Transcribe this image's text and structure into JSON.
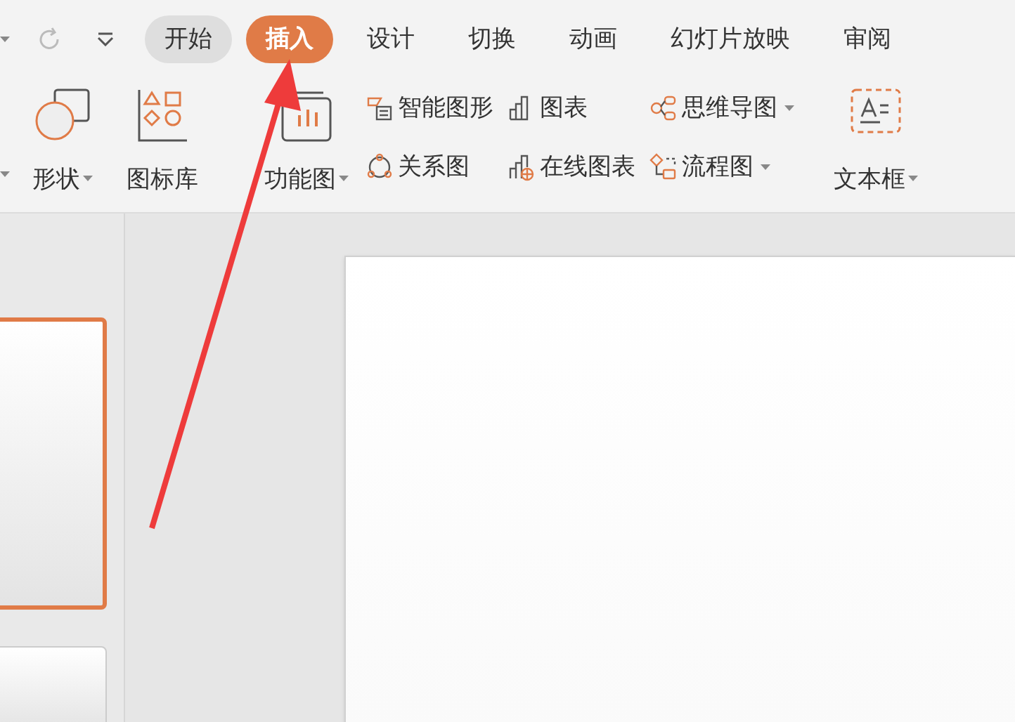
{
  "tabs": [
    {
      "label": "开始",
      "selected": false,
      "hovered": true
    },
    {
      "label": "插入",
      "selected": true,
      "hovered": false
    },
    {
      "label": "设计",
      "selected": false,
      "hovered": false
    },
    {
      "label": "切换",
      "selected": false,
      "hovered": false
    },
    {
      "label": "动画",
      "selected": false,
      "hovered": false
    },
    {
      "label": "幻灯片放映",
      "selected": false,
      "hovered": false
    },
    {
      "label": "审阅",
      "selected": false,
      "hovered": false
    }
  ],
  "ribbon": {
    "large": [
      {
        "kind": "shape",
        "label": "形状",
        "dropdown": true
      },
      {
        "kind": "iconlib",
        "label": "图标库",
        "dropdown": false
      },
      {
        "kind": "function",
        "label": "功能图",
        "dropdown": true
      }
    ],
    "small_columns": [
      [
        {
          "kind": "smart",
          "label": "智能图形",
          "dropdown": false
        },
        {
          "kind": "relation",
          "label": "关系图",
          "dropdown": false
        }
      ],
      [
        {
          "kind": "chart",
          "label": "图表",
          "dropdown": false
        },
        {
          "kind": "online",
          "label": "在线图表",
          "dropdown": false
        }
      ],
      [
        {
          "kind": "mind",
          "label": "思维导图",
          "dropdown": true
        },
        {
          "kind": "flow",
          "label": "流程图",
          "dropdown": true
        }
      ]
    ],
    "textbox": {
      "label": "文本框",
      "dropdown": true
    }
  },
  "thumbnails": [
    {
      "selected": true
    },
    {
      "selected": false
    }
  ],
  "annotation": {
    "kind": "arrow"
  }
}
